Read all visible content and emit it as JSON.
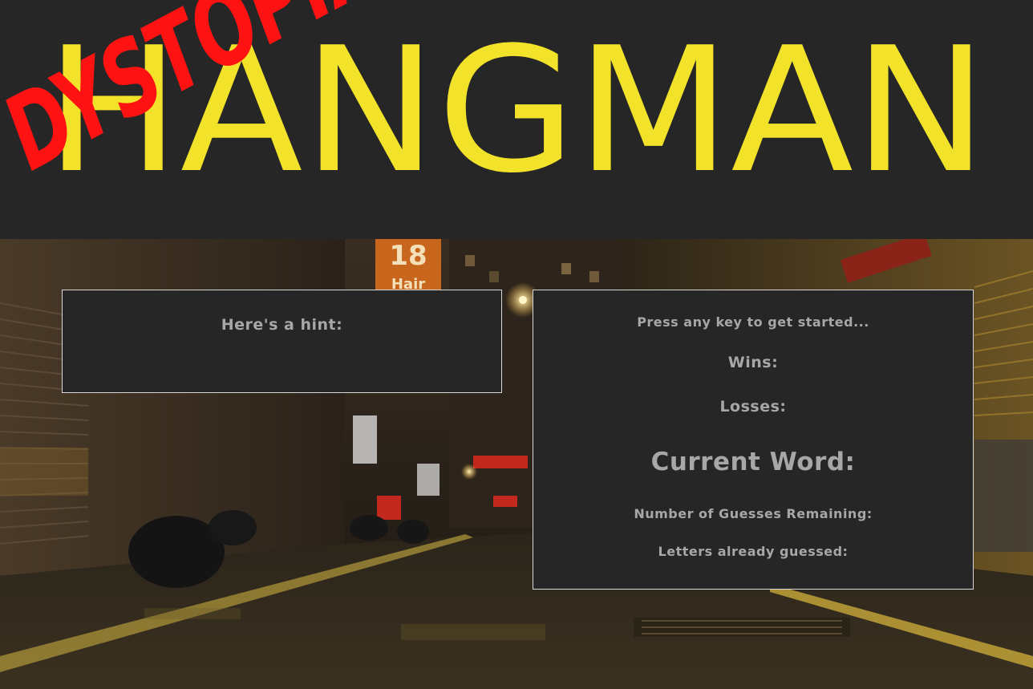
{
  "header": {
    "title": "HANGMAN",
    "overlay_word": "DYSTOPIA",
    "title_color": "#f2e22a",
    "overlay_color": "#ff1212"
  },
  "background": {
    "description_icon": "night-alley-photo",
    "sign_number": "18",
    "sign_text": "Hair"
  },
  "hint_panel": {
    "label": "Here's a hint:"
  },
  "game_panel": {
    "prompt": "Press any key to get started...",
    "wins_label": "Wins:",
    "losses_label": "Losses:",
    "current_word_label": "Current Word:",
    "guesses_remaining_label": "Number of Guesses Remaining:",
    "letters_guessed_label": "Letters already guessed:"
  },
  "colors": {
    "panel_bg": "#262626",
    "panel_text": "#a7a7a7",
    "panel_border": "#d8d8d8"
  }
}
